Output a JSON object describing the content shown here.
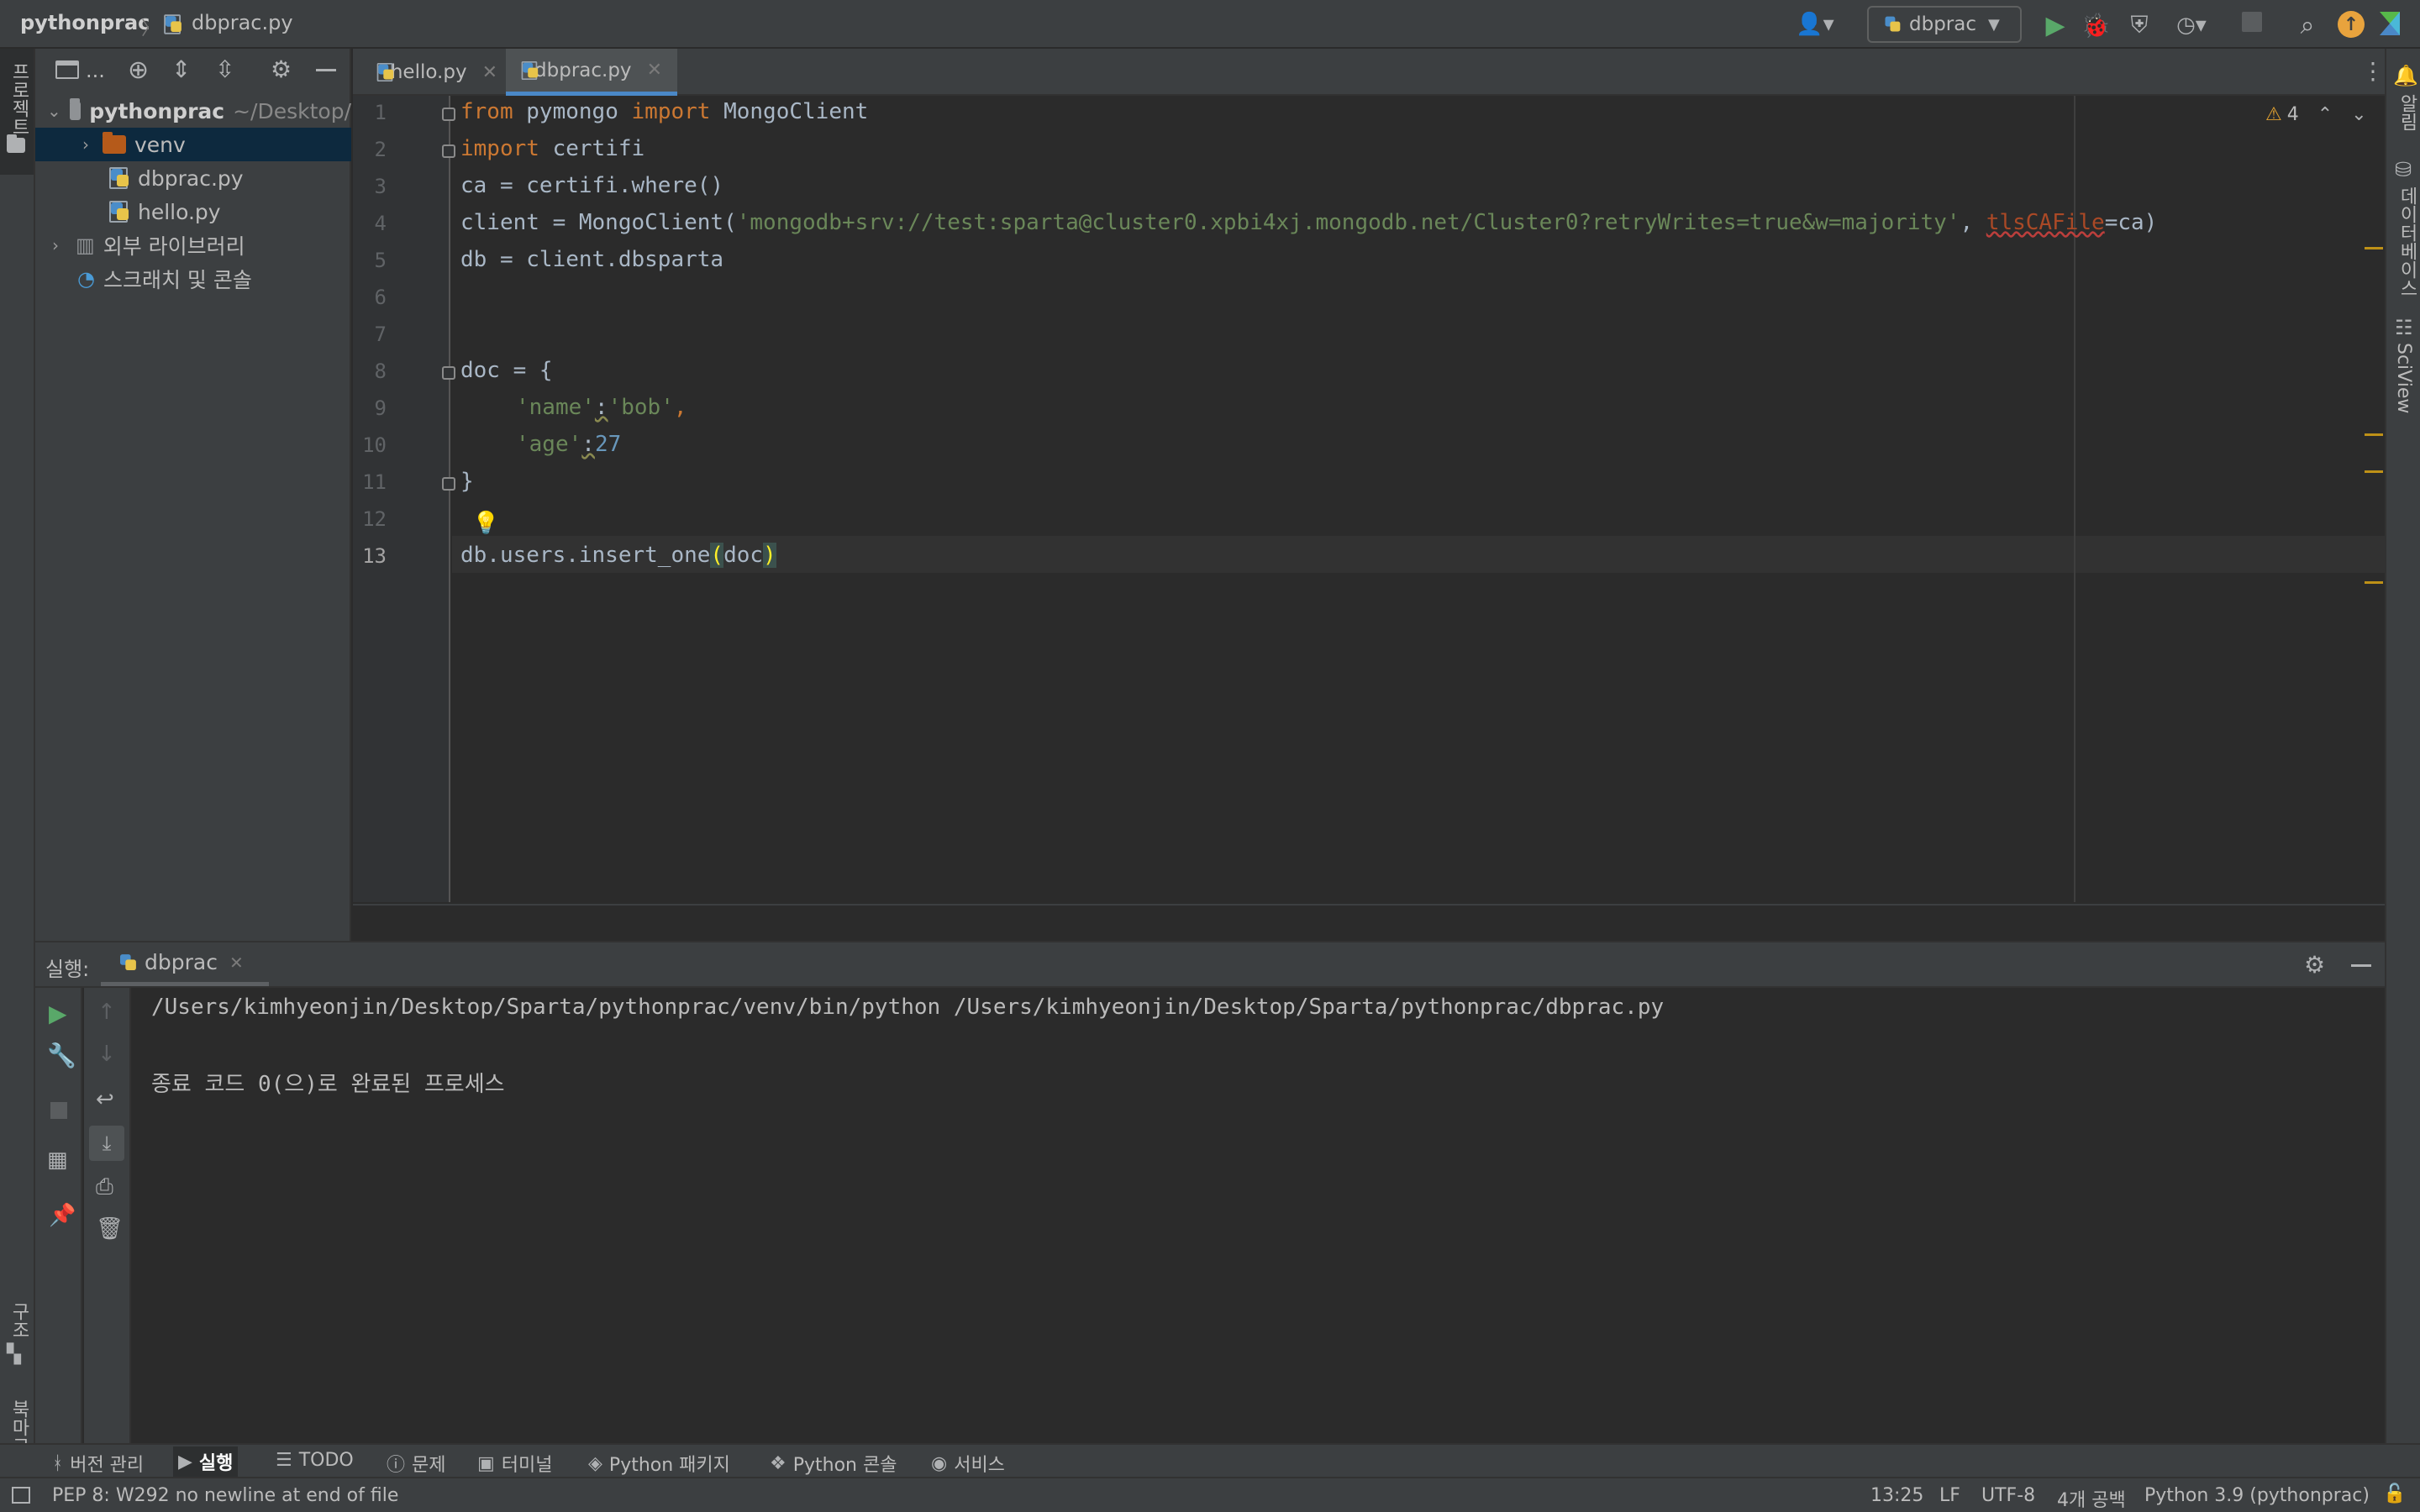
{
  "breadcrumb": {
    "project": "pythonprac",
    "file": "dbprac.py"
  },
  "toolbar": {
    "run_config": "dbprac"
  },
  "left_strip": {
    "project_label": "프로젝트",
    "structure_label": "구조",
    "bookmarks_label": "북마크"
  },
  "right_strip": {
    "notifications_label": "알림",
    "database_label": "데이터베이스",
    "sciview_label": "SciView"
  },
  "project_tree": {
    "toolbar_label": "...",
    "root": {
      "name": "pythonprac",
      "path": "~/Desktop/"
    },
    "items": [
      {
        "label": "venv"
      },
      {
        "label": "dbprac.py"
      },
      {
        "label": "hello.py"
      },
      {
        "label": "외부 라이브러리"
      },
      {
        "label": "스크래치 및 콘솔"
      }
    ]
  },
  "tabs": [
    {
      "label": "hello.py"
    },
    {
      "label": "dbprac.py"
    }
  ],
  "editor": {
    "inspection_count": "4",
    "line_numbers": [
      "1",
      "2",
      "3",
      "4",
      "5",
      "6",
      "7",
      "8",
      "9",
      "10",
      "11",
      "12",
      "13"
    ],
    "code": {
      "l1_kw1": "from",
      "l1_mod": " pymongo ",
      "l1_kw2": "import",
      "l1_rest": " MongoClient",
      "l2_kw": "import",
      "l2_rest": " certifi",
      "l3": "ca = certifi.where()",
      "l4_pre": "client = MongoClient(",
      "l4_str": "'mongodb+srv://test:sparta@cluster0.xpbi4xj.mongodb.net/Cluster0?retryWrites=true&w=majority'",
      "l4_comma": ", ",
      "l4_param": "tlsCAFile",
      "l4_post": "=ca)",
      "l5": "db = client.dbsparta",
      "l8": "doc = {",
      "l9_str1": "'name'",
      "l9_colon": ":",
      "l9_str2": "'bob'",
      "l9_comma": ",",
      "l10_str": "'age'",
      "l10_colon": ":",
      "l10_num": "27",
      "l11": "}",
      "l13_pre": "db.users.insert_one",
      "l13_open": "(",
      "l13_arg": "doc",
      "l13_close": ")"
    }
  },
  "run_panel": {
    "label": "실행:",
    "tab": "dbprac",
    "output": [
      "/Users/kimhyeonjin/Desktop/Sparta/pythonprac/venv/bin/python /Users/kimhyeonjin/Desktop/Sparta/pythonprac/dbprac.py",
      "종료 코드 0(으)로 완료된 프로세스"
    ]
  },
  "bottom_tools": [
    {
      "label": "버전 관리"
    },
    {
      "label": "실행"
    },
    {
      "label": "TODO"
    },
    {
      "label": "문제"
    },
    {
      "label": "터미널"
    },
    {
      "label": "Python 패키지"
    },
    {
      "label": "Python 콘솔"
    },
    {
      "label": "서비스"
    }
  ],
  "status_bar": {
    "message": "PEP 8: W292 no newline at end of file",
    "position": "13:25",
    "line_sep": "LF",
    "encoding": "UTF-8",
    "indent": "4개 공백",
    "interpreter": "Python 3.9 (pythonprac)"
  },
  "colors": {
    "keyword": "#cc7832",
    "string": "#6a8759",
    "number": "#6897bb",
    "accent": "#4a88c7",
    "run_green": "#59a869"
  }
}
